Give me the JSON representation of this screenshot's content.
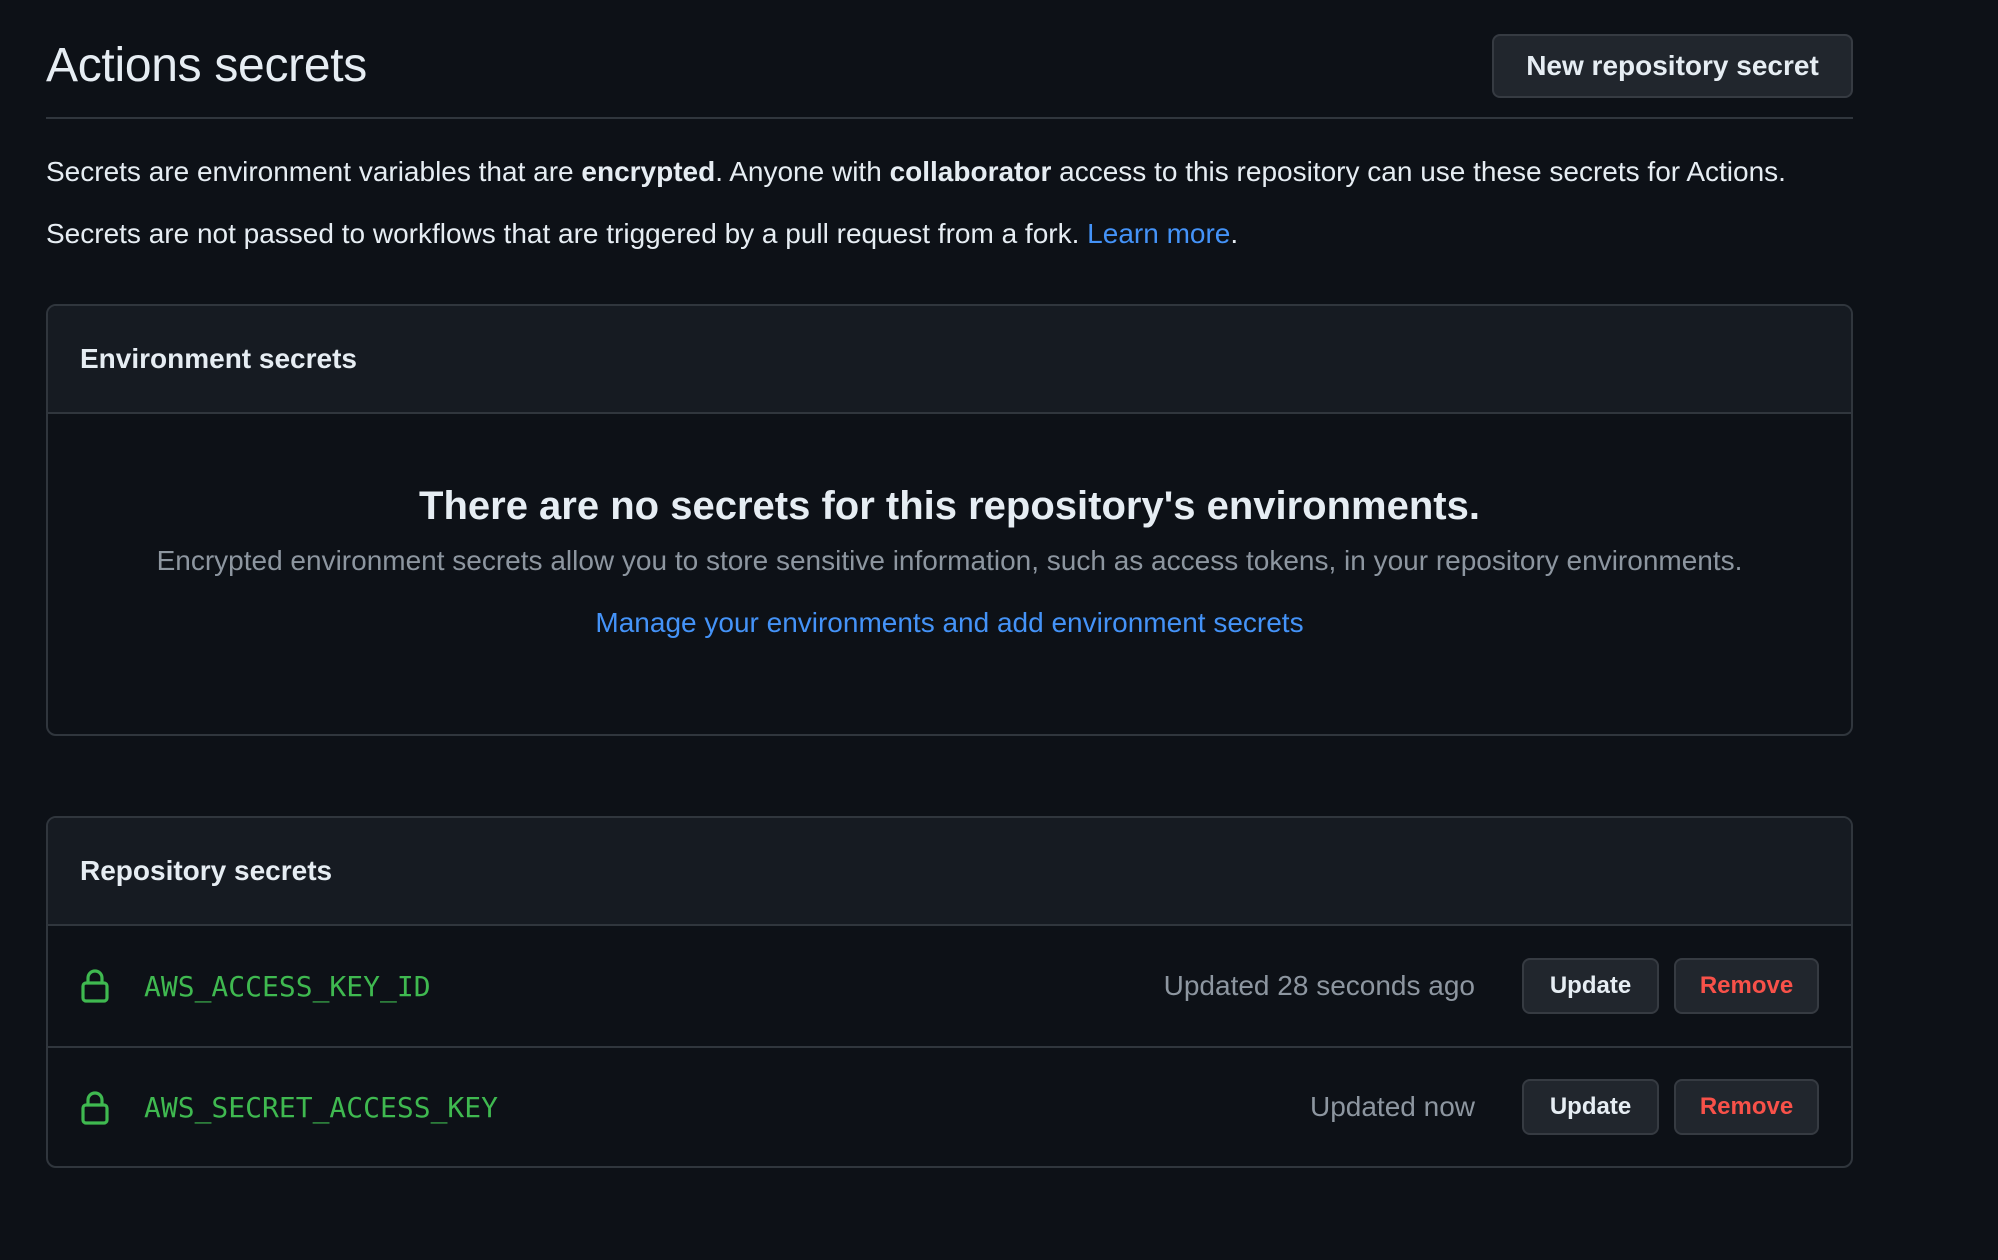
{
  "header": {
    "title": "Actions secrets",
    "new_secret_button": "New repository secret"
  },
  "intro": {
    "line1_part1": "Secrets are environment variables that are ",
    "line1_bold1": "encrypted",
    "line1_part2": ". Anyone with ",
    "line1_bold2": "collaborator",
    "line1_part3": " access to this repository can use these secrets for Actions.",
    "line2_text": "Secrets are not passed to workflows that are triggered by a pull request from a fork. ",
    "line2_link": "Learn more",
    "line2_end": "."
  },
  "environment_secrets": {
    "heading": "Environment secrets",
    "empty_title": "There are no secrets for this repository's environments.",
    "empty_description": "Encrypted environment secrets allow you to store sensitive information, such as access tokens, in your repository environments.",
    "manage_link": "Manage your environments and add environment secrets"
  },
  "repository_secrets": {
    "heading": "Repository secrets",
    "items": [
      {
        "name": "AWS_ACCESS_KEY_ID",
        "updated": "Updated 28 seconds ago",
        "update_label": "Update",
        "remove_label": "Remove"
      },
      {
        "name": "AWS_SECRET_ACCESS_KEY",
        "updated": "Updated now",
        "update_label": "Update",
        "remove_label": "Remove"
      }
    ]
  },
  "icons": {
    "secret_icon": "lock-icon"
  },
  "colors": {
    "background": "#0d1117",
    "panel_header": "#161b22",
    "border": "#30363d",
    "text": "#e6edf3",
    "muted": "#8d96a0",
    "link": "#4493f8",
    "secret_name": "#3fb950",
    "danger": "#f85149"
  }
}
